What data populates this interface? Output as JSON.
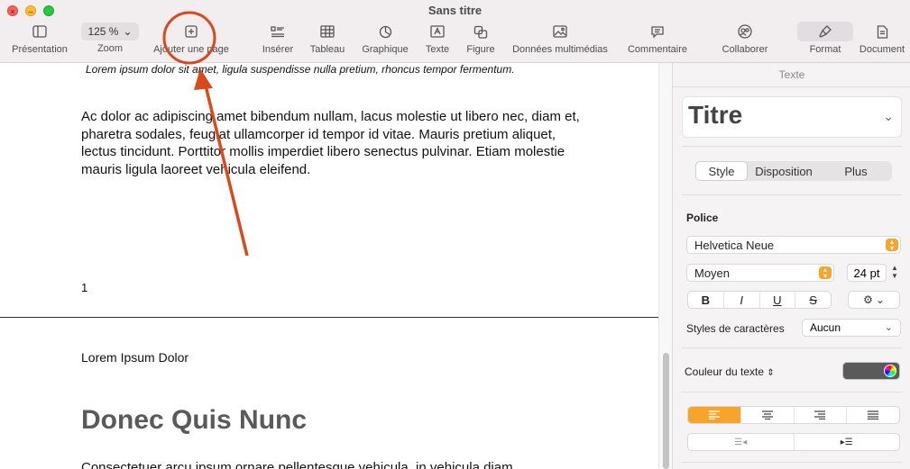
{
  "window": {
    "title": "Sans titre"
  },
  "toolbar": {
    "presentation": "Présentation",
    "zoom_value": "125 %",
    "zoom": "Zoom",
    "add_page": "Ajouter une page",
    "insert": "Insérer",
    "table": "Tableau",
    "chart": "Graphique",
    "text": "Texte",
    "shape": "Figure",
    "media": "Données multimédias",
    "comment": "Commentaire",
    "collaborate": "Collaborer",
    "format": "Format",
    "document": "Document"
  },
  "document": {
    "caption": "Lorem ipsum dolor sit amet, ligula suspendisse nulla pretium, rhoncus tempor fermentum.",
    "body": "Ac dolor ac adipiscing amet bibendum nullam, lacus molestie ut libero nec, diam et, pharetra sodales, feugiat ullamcorper id tempor id vitae. Mauris pretium aliquet, lectus tincidunt. Porttitor mollis imperdiet libero senectus pulvinar. Etiam molestie mauris ligula laoreet vehicula eleifend.",
    "page_number": "1",
    "header": "Lorem Ipsum Dolor",
    "heading": "Donec Quis Nunc",
    "next_paragraph": "Consectetuer arcu ipsum ornare pellentesque vehicula, in vehicula diam"
  },
  "inspector": {
    "header": "Texte",
    "paragraph_style": "Titre",
    "tabs": [
      "Style",
      "Disposition",
      "Plus"
    ],
    "font_section": "Police",
    "font_family": "Helvetica Neue",
    "font_weight": "Moyen",
    "font_size": "24 pt",
    "bold": "B",
    "italic": "I",
    "underline": "U",
    "strikethrough": "S",
    "char_styles_label": "Styles de caractères",
    "char_styles_value": "Aucun",
    "text_color_label": "Couleur du texte"
  },
  "colors": {
    "accent": "#f8a42b",
    "annotation": "#d84a1b",
    "text_color_well": "#5a5a5a"
  }
}
